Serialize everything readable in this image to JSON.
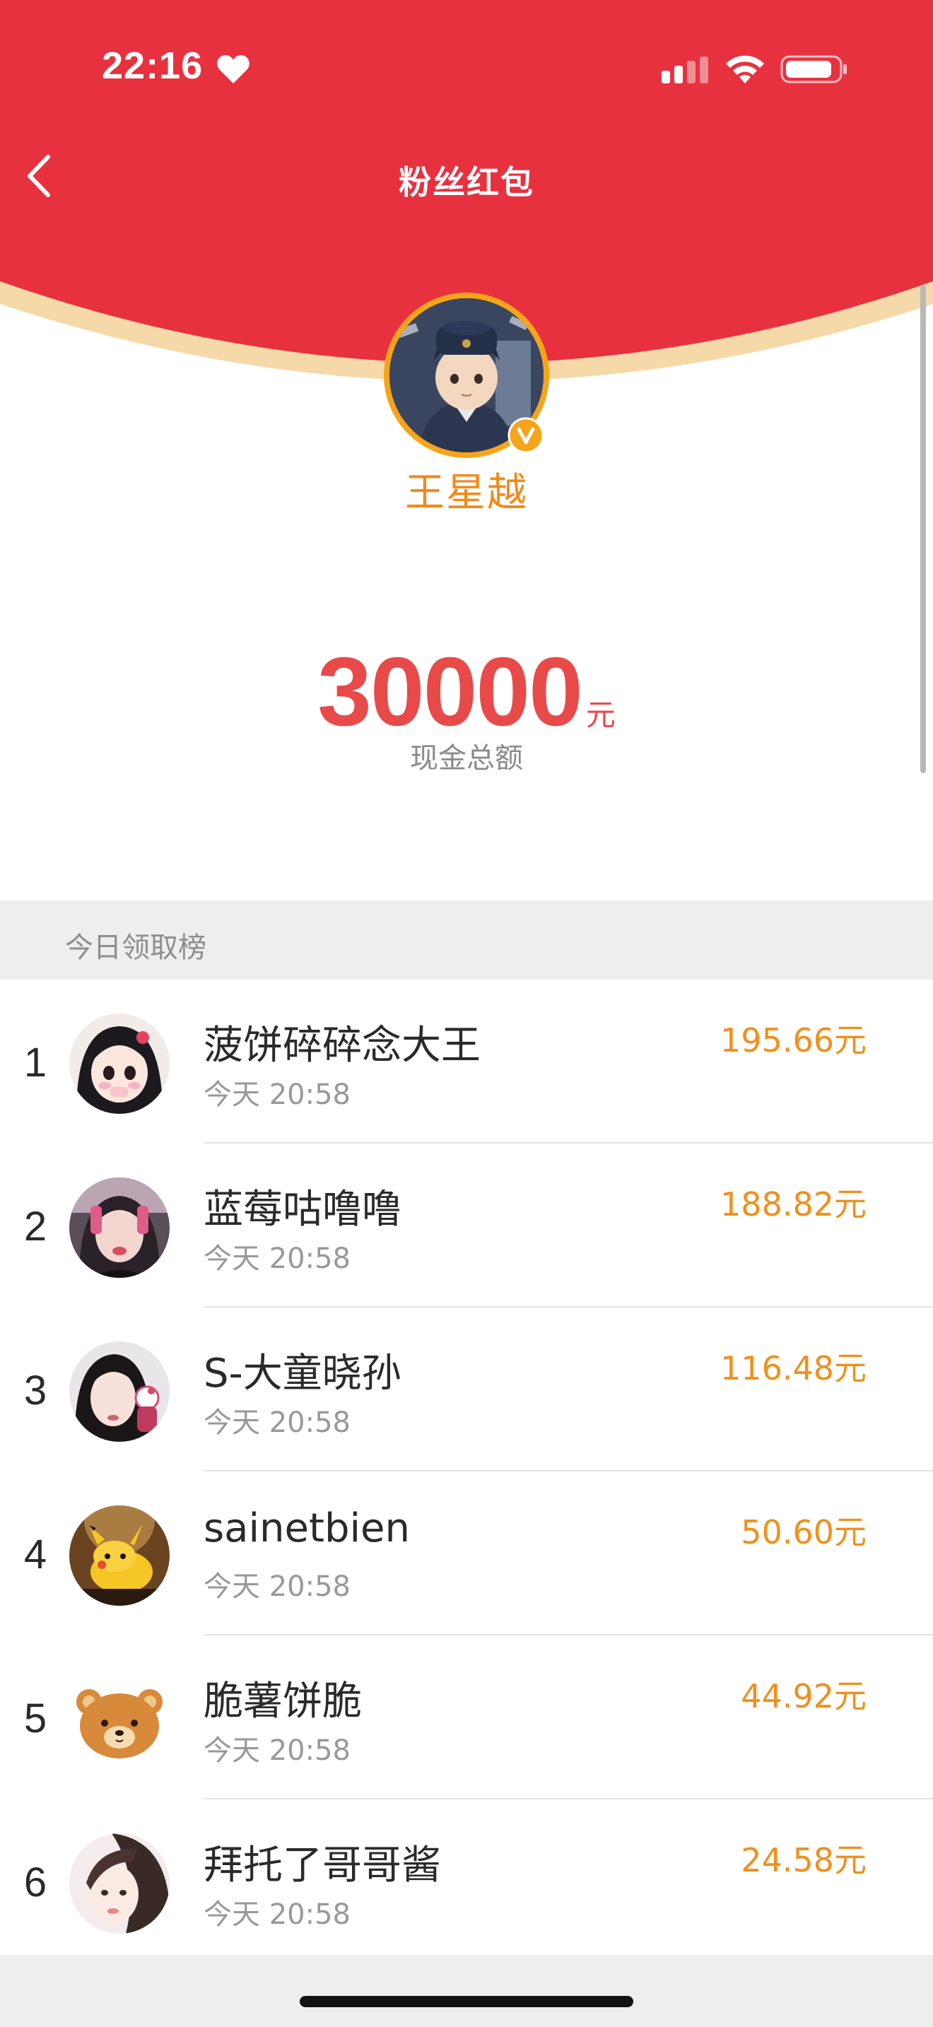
{
  "status_bar": {
    "time": "22:16"
  },
  "nav": {
    "title": "粉丝红包"
  },
  "owner": {
    "name": "王星越"
  },
  "total": {
    "amount": "30000",
    "unit": "元",
    "label": "现金总额"
  },
  "ranking": {
    "title": "今日领取榜",
    "items": [
      {
        "rank": "1",
        "name": "菠饼碎碎念大王",
        "time": "今天 20:58",
        "amount": "195.66元"
      },
      {
        "rank": "2",
        "name": "蓝莓咕噜噜",
        "time": "今天 20:58",
        "amount": "188.82元"
      },
      {
        "rank": "3",
        "name": "S-大童晓孙",
        "time": "今天 20:58",
        "amount": "116.48元"
      },
      {
        "rank": "4",
        "name": "sainetbien",
        "time": "今天 20:58",
        "amount": "50.60元"
      },
      {
        "rank": "5",
        "name": "脆薯饼脆",
        "time": "今天 20:58",
        "amount": "44.92元"
      },
      {
        "rank": "6",
        "name": "拜托了哥哥酱",
        "time": "今天 20:58",
        "amount": "24.58元"
      }
    ]
  },
  "colors": {
    "header_red": "#e8313f",
    "amount_red": "#e84a4a",
    "accent_orange": "#f0901c",
    "name_orange": "#f28a1a"
  }
}
